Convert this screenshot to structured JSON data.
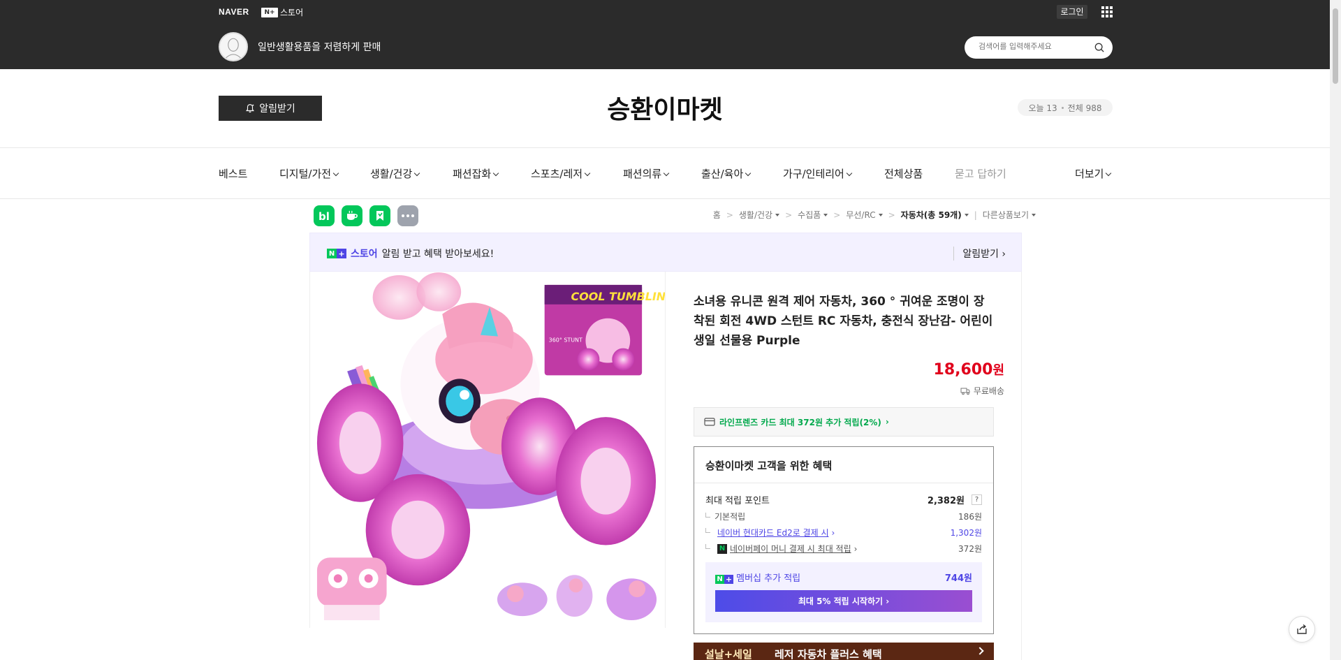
{
  "topbar": {
    "naver": "NAVER",
    "nplus_box": "N+",
    "nplus_store": "스토어",
    "login": "로그인",
    "store_description": "일반생활용품을 저렴하게 판매",
    "search_placeholder": "검색어를 입력해주세요"
  },
  "header": {
    "notify_button": "알림받기",
    "store_name": "승환이마켓",
    "visitors_today": "오늘 13",
    "visitors_total": "전체 988"
  },
  "nav": {
    "items": [
      {
        "label": "베스트"
      },
      {
        "label": "디지털/가전"
      },
      {
        "label": "생활/건강"
      },
      {
        "label": "패션잡화"
      },
      {
        "label": "스포츠/레저"
      },
      {
        "label": "패션의류"
      },
      {
        "label": "출산/육아"
      },
      {
        "label": "가구/인테리어"
      },
      {
        "label": "전체상품"
      },
      {
        "label": "묻고 답하기"
      },
      {
        "label": "더보기"
      }
    ]
  },
  "apps": [
    {
      "name": "blog-app-icon",
      "glyph": "b|",
      "color": "#03c75a"
    },
    {
      "name": "cafe-app-icon",
      "glyph": "☕",
      "color": "#03c75a"
    },
    {
      "name": "bookmark-app-icon",
      "glyph": "⚑",
      "color": "#03c75a"
    },
    {
      "name": "more-app-icon",
      "glyph": "•••",
      "color": "#9ea3ad"
    }
  ],
  "breadcrumb": {
    "home": "홈",
    "c1": "생활/건강",
    "c2": "수집품",
    "c3": "무선/RC",
    "c4": "자동차(총 59개)",
    "other": "다른상품보기"
  },
  "promo": {
    "n": "N",
    "plus": "+",
    "brand": "스토어",
    "text": "알림 받고 혜택 받아보세요!",
    "action": "알림받기"
  },
  "product": {
    "title": "소녀용 유니콘 원격 제어 자동차, 360 ° 귀여운 조명이 장착된 회전 4WD 스턴트 RC 자동차, 충전식 장난감- 어린이 생일 선물용 Purple",
    "price": "18,600",
    "price_unit": "원",
    "delivery": "무료배송",
    "card_benefit": "라인프렌즈 카드 최대 372원 추가 적립(2%)",
    "box_text": "COOL TUMBLING",
    "box_stunt": "360° STUNT"
  },
  "benefit": {
    "title": "승환이마켓 고객을 위한 혜택",
    "max_points_label": "최대 적립 포인트",
    "max_points_value": "2,382원",
    "qmark": "?",
    "rows": [
      {
        "label": "기본적립",
        "value": "186원"
      },
      {
        "label": "네이버 현대카드 Ed2로 결제 시",
        "value": "1,302원"
      },
      {
        "label": "네이버페이 머니 결제 시 최대 적립",
        "value": "372원"
      }
    ],
    "npay_badge": "N",
    "member_label": "멤버십 추가 적립",
    "member_value": "744원",
    "member_button": "최대 5% 적립 시작하기"
  },
  "sale_banner": {
    "left": "설날+세일",
    "right": "레저 자동차 플러스 혜택"
  }
}
